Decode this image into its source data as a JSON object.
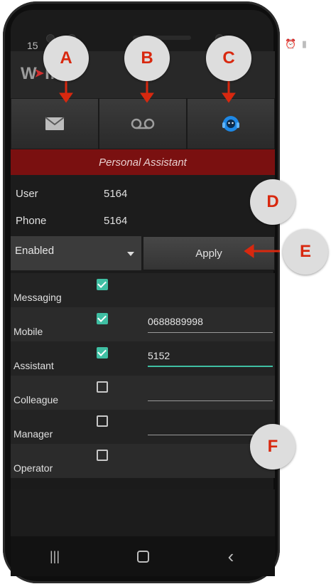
{
  "status_bar": {
    "time": "15",
    "icons": "⏰ ▮"
  },
  "app": {
    "logo_text": "W",
    "logo_suffix": "IN"
  },
  "tabs": [
    {
      "name": "messages",
      "icon": "envelope-icon"
    },
    {
      "name": "voicemail",
      "icon": "voicemail-icon"
    },
    {
      "name": "assistant",
      "icon": "headset-icon"
    }
  ],
  "header": {
    "title": "Personal Assistant"
  },
  "info": {
    "user_label": "User",
    "user_value": "5164",
    "phone_label": "Phone",
    "phone_value": "5164"
  },
  "controls": {
    "dropdown_value": "Enabled",
    "apply_label": "Apply"
  },
  "forwarding": [
    {
      "label": "Messaging",
      "checked": true,
      "value": null
    },
    {
      "label": "Mobile",
      "checked": true,
      "value": "0688889998"
    },
    {
      "label": "Assistant",
      "checked": true,
      "value": "5152"
    },
    {
      "label": "Colleague",
      "checked": false,
      "value": ""
    },
    {
      "label": "Manager",
      "checked": false,
      "value": ""
    },
    {
      "label": "Operator",
      "checked": false,
      "value": null
    }
  ],
  "navbar": {
    "recents": "|||",
    "back": "‹"
  },
  "callouts": {
    "a": "A",
    "b": "B",
    "c": "C",
    "d": "D",
    "e": "E",
    "f": "F"
  },
  "colors": {
    "accent_teal": "#3fbfa3",
    "header_red": "#7a1010",
    "callout_red": "#d8280f",
    "assistant_blue": "#1e88e5"
  }
}
